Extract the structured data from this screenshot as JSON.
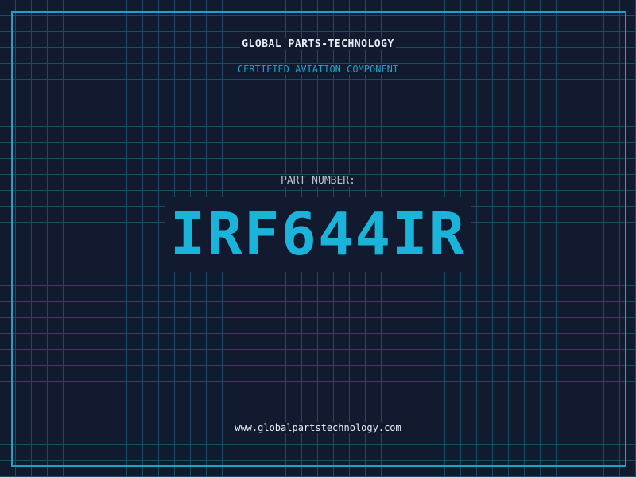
{
  "header": {
    "company": "GLOBAL PARTS-TECHNOLOGY",
    "subtitle": "CERTIFIED AVIATION COMPONENT"
  },
  "part": {
    "label": "PART NUMBER:",
    "number": "IRF644IR"
  },
  "footer": {
    "website": "www.globalpartstechnology.com"
  },
  "colors": {
    "background": "#111a2e",
    "grid": "#1c4c63",
    "accent": "#1ab3d9",
    "text": "#e8eef5"
  }
}
